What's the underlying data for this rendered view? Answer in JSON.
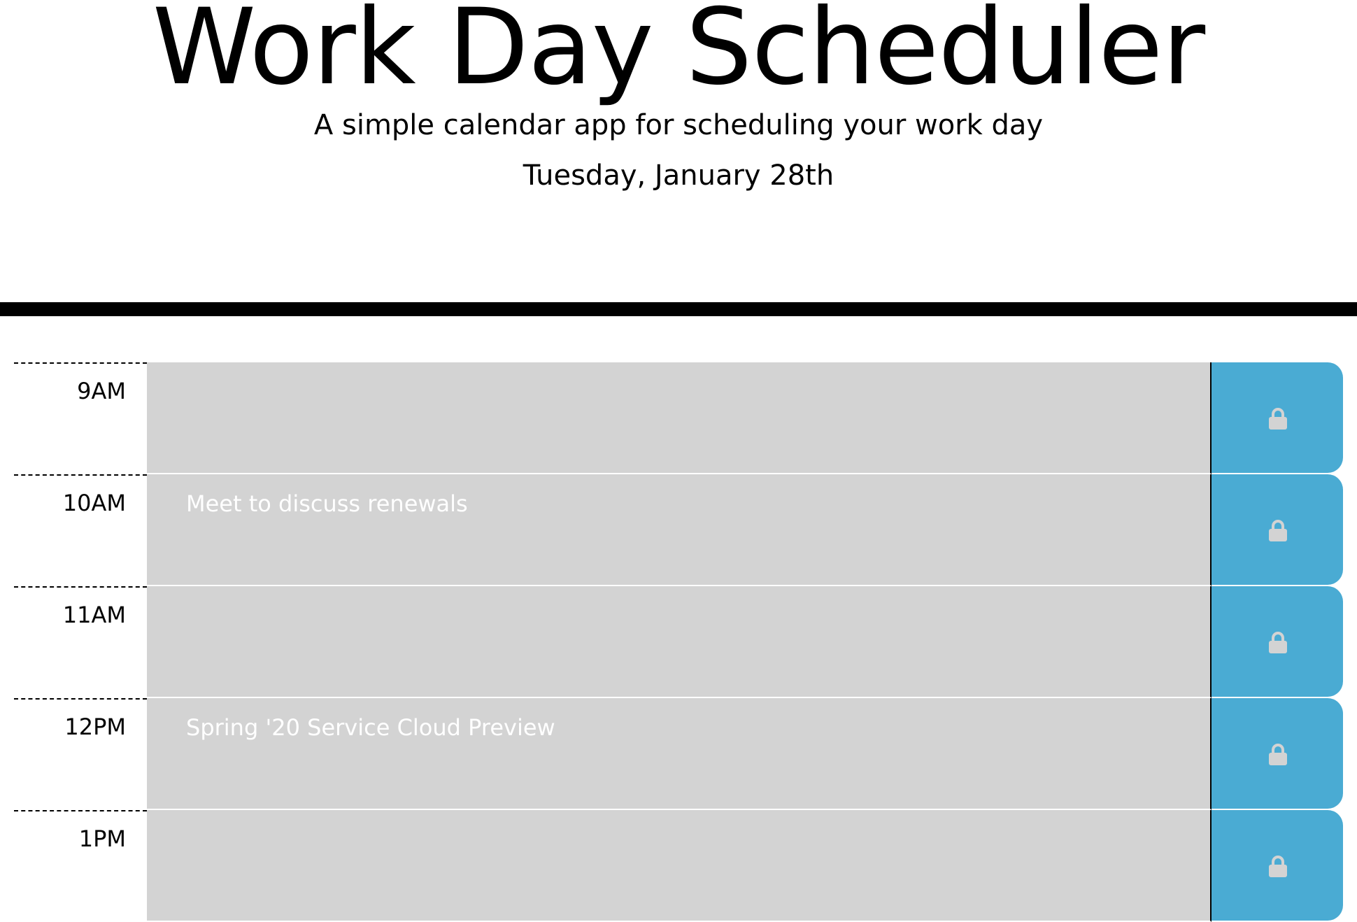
{
  "header": {
    "title": "Work Day Scheduler",
    "subtitle": "A simple calendar app for scheduling your work day",
    "current_day": "Tuesday, January 28th"
  },
  "rows": [
    {
      "hour": "9AM",
      "text": ""
    },
    {
      "hour": "10AM",
      "text": "Meet to discuss renewals"
    },
    {
      "hour": "11AM",
      "text": ""
    },
    {
      "hour": "12PM",
      "text": "Spring '20 Service Cloud Preview"
    },
    {
      "hour": "1PM",
      "text": ""
    }
  ],
  "colors": {
    "past_block": "#d3d3d3",
    "save_button": "#4aabd3",
    "lock_icon": "#d3d3d3",
    "divider": "#000000"
  },
  "icons": {
    "save": "lock-icon"
  }
}
